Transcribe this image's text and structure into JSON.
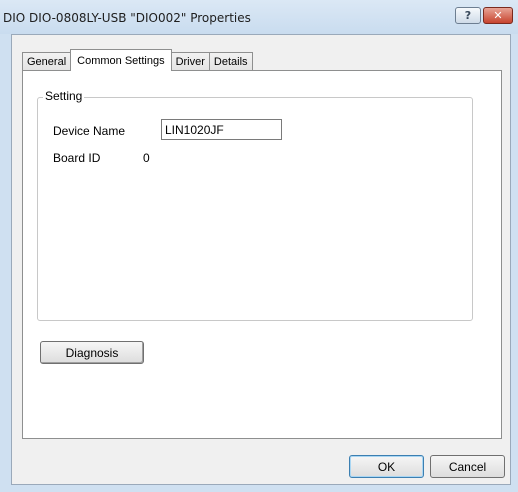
{
  "window": {
    "title": "DIO DIO-0808LY-USB \"DIO002\" Properties",
    "help_label": "?",
    "close_label": "✕"
  },
  "tabs": [
    {
      "label": "General",
      "active": false
    },
    {
      "label": "Common Settings",
      "active": true
    },
    {
      "label": "Driver",
      "active": false
    },
    {
      "label": "Details",
      "active": false
    }
  ],
  "setting_group": {
    "legend": "Setting",
    "device_name_label": "Device Name",
    "device_name_value": "LIN1020JF",
    "board_id_label": "Board ID",
    "board_id_value": "0"
  },
  "buttons": {
    "diagnosis": "Diagnosis",
    "ok": "OK",
    "cancel": "Cancel"
  }
}
